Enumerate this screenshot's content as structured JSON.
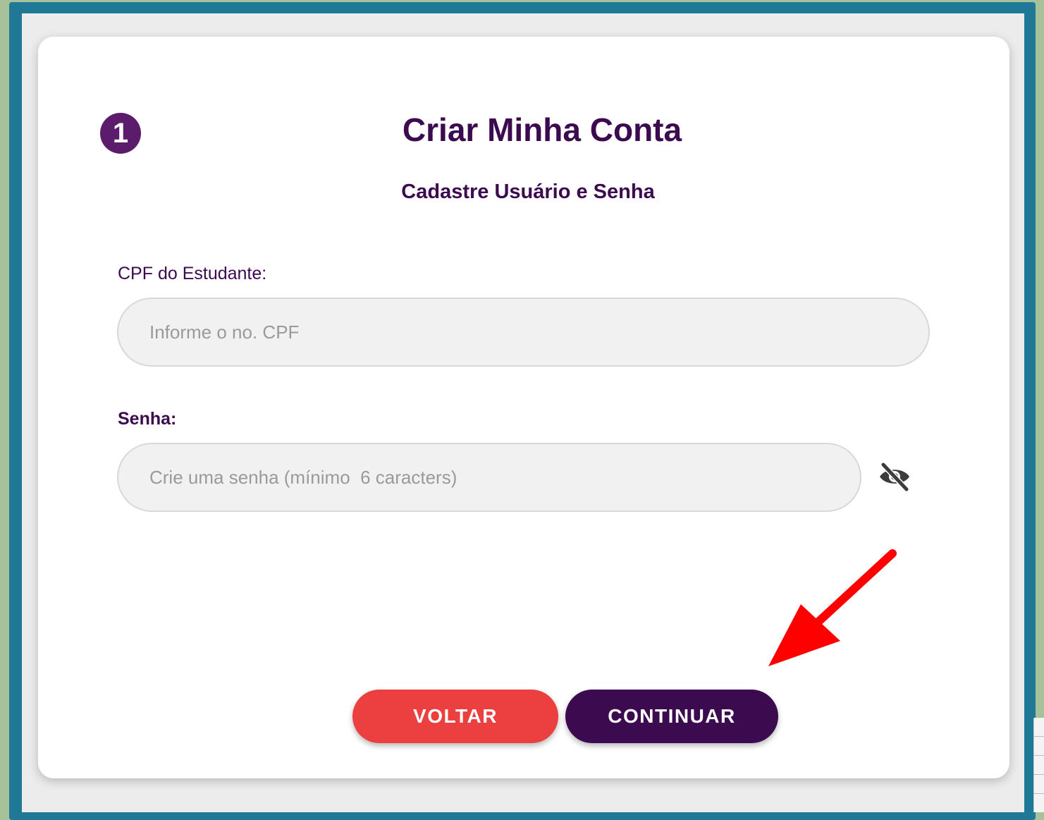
{
  "form": {
    "step_number": "1",
    "title": "Criar Minha Conta",
    "subtitle": "Cadastre Usuário e Senha",
    "cpf_label": "CPF do Estudante:",
    "cpf_placeholder": "Informe o no. CPF",
    "cpf_value": "",
    "senha_label": "Senha:",
    "senha_placeholder": "Crie uma senha (mínimo  6 caracters)",
    "senha_value": "",
    "password_toggle_icon": "eye-slash-icon"
  },
  "buttons": {
    "voltar_label": "VOLTAR",
    "continuar_label": "CONTINUAR"
  },
  "annotation": {
    "arrow_icon": "red-arrow-icon",
    "arrow_color": "#ff0000"
  },
  "colors": {
    "primary": "#3b0a4f",
    "danger": "#ec3f3f",
    "frame": "#1e7896"
  }
}
